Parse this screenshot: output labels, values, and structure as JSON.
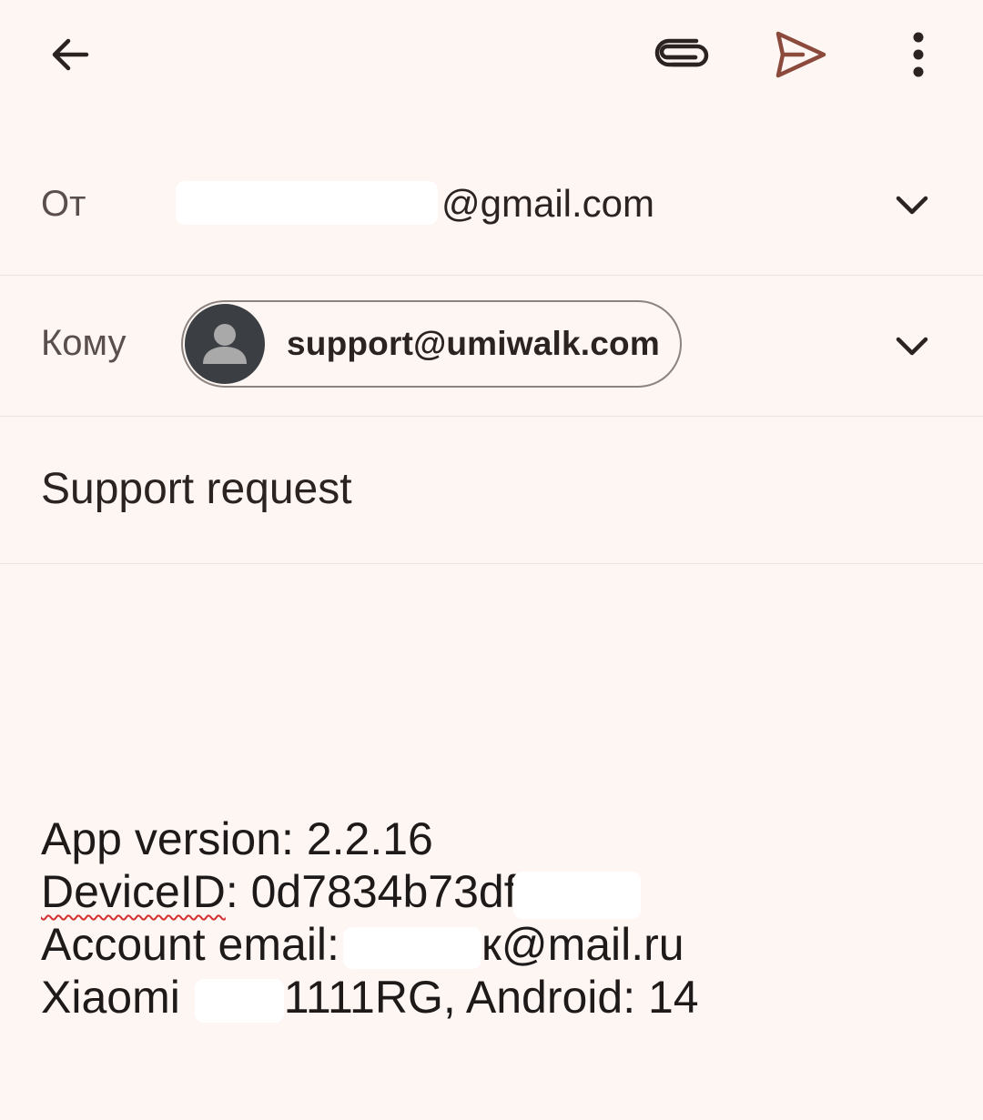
{
  "toolbar": {
    "icons": {
      "back": "arrow-left-icon",
      "attach": "paperclip-icon",
      "send": "send-icon",
      "more": "more-vertical-icon"
    },
    "send_color": "#8b4a3c"
  },
  "from": {
    "label": "От",
    "value_visible": "@gmail.com",
    "value_prefix_fragment": "",
    "icon": "chevron-down-icon"
  },
  "to": {
    "label": "Кому",
    "recipient": "support@umiwalk.com",
    "avatar_icon": "person-avatar-icon",
    "icon": "chevron-down-icon"
  },
  "subject": {
    "value": "Support request"
  },
  "body": {
    "line1": "App version: 2.2.16",
    "line2_label": "DeviceID",
    "line2_rest": ": 0d7834b73df",
    "line3_prefix": "Account email:",
    "line3_suffix": "к@mail.ru",
    "line4_prefix": "Xiaomi",
    "line4_suffix": "1111RG, Android: 14"
  },
  "colors": {
    "background": "#fdf6f3",
    "text": "#2b2222",
    "spellcheck": "#d32f2f"
  }
}
